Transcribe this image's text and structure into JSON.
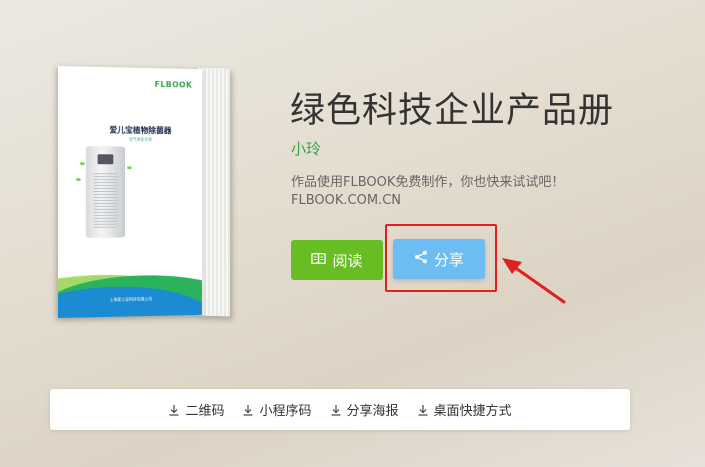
{
  "book": {
    "brand": "FLBOOK",
    "cover_title": "爱儿宝植物除菌器",
    "cover_subtitle": "空气净化专家",
    "cover_footer": "上海爱儿宝科技有限公司"
  },
  "header": {
    "title": "绿色科技企业产品册",
    "author": "小玲",
    "desc_line1": "作品使用FLBOOK免费制作，你也快来试试吧！",
    "desc_line2": "FLBOOK.COM.CN"
  },
  "actions": {
    "read_label": "阅读",
    "share_label": "分享"
  },
  "annotation": {
    "box_color": "#e0201d",
    "arrow_color": "#e0201d"
  },
  "bottom_bar": {
    "items": [
      {
        "label": "二维码",
        "icon": "download-icon"
      },
      {
        "label": "小程序码",
        "icon": "download-icon"
      },
      {
        "label": "分享海报",
        "icon": "download-icon"
      },
      {
        "label": "桌面快捷方式",
        "icon": "download-icon"
      }
    ]
  },
  "colors": {
    "read_button": "#67bd21",
    "share_button": "#6dbdf2",
    "author": "#3aa14b"
  }
}
